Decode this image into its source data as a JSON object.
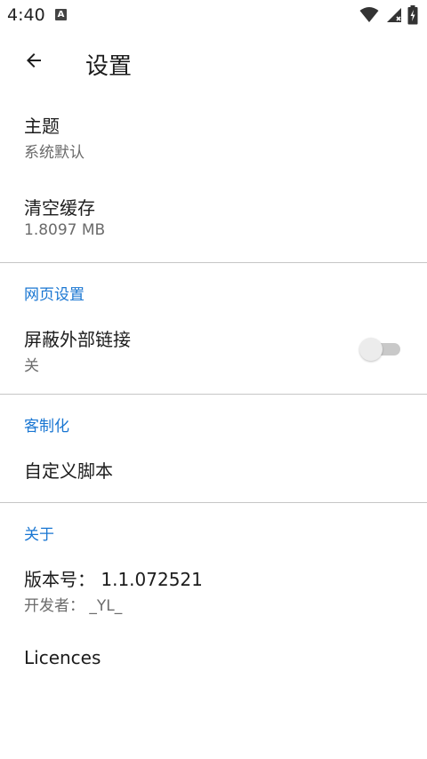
{
  "status_bar": {
    "time": "4:40",
    "notification_glyph": "A"
  },
  "app_bar": {
    "title": "设置"
  },
  "items": {
    "theme": {
      "title": "主题",
      "subtitle": "系统默认"
    },
    "clear_cache": {
      "title": "清空缓存",
      "subtitle": "1.8097 MB"
    },
    "block_links": {
      "title": "屏蔽外部链接",
      "subtitle": "关",
      "enabled": false
    },
    "custom_script": {
      "title": "自定义脚本"
    },
    "version": {
      "title": "版本号： 1.1.072521",
      "subtitle": "开发者： _YL_"
    },
    "licences": {
      "title": "Licences"
    }
  },
  "sections": {
    "web": "网页设置",
    "custom": "客制化",
    "about": "关于"
  },
  "icons": {
    "back": "arrow-back-icon",
    "wifi": "wifi-icon",
    "signal": "signal-icon",
    "battery": "battery-icon"
  },
  "colors": {
    "accent": "#1976d2",
    "divider": "#c6c6c6",
    "switch_off_track": "#c9c9c9",
    "switch_off_thumb": "#ececec"
  }
}
